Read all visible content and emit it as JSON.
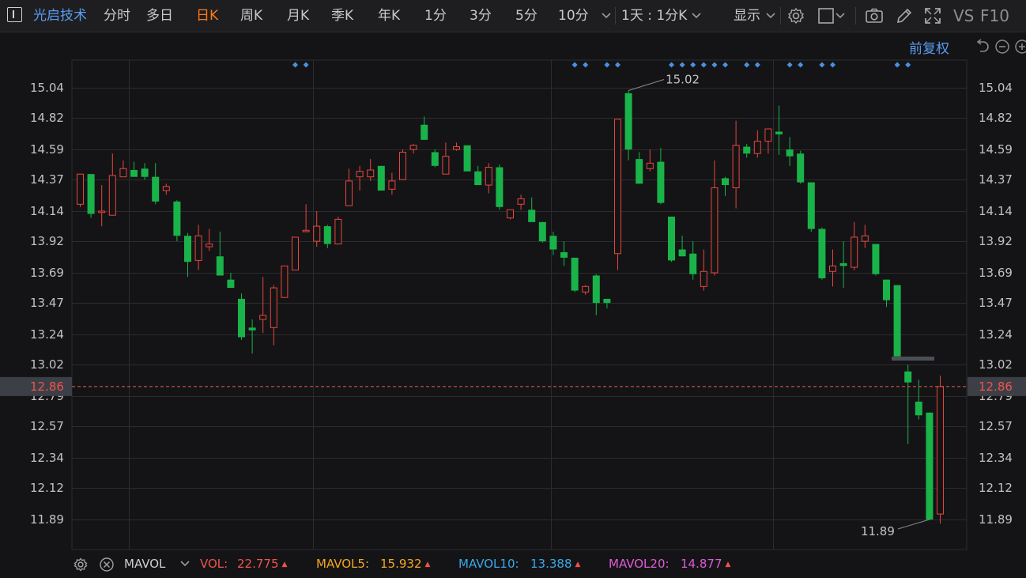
{
  "toolbar": {
    "stock_name": "光启技术",
    "periods": [
      "分时",
      "多日",
      "日K",
      "周K",
      "月K",
      "季K",
      "年K",
      "1分",
      "3分",
      "5分",
      "10分"
    ],
    "active_period": "日K",
    "interval_label": "1天 : 1分K",
    "display_label": "显示",
    "extra_labels": [
      "VS",
      "F10"
    ]
  },
  "sub_toolbar": {
    "adjust_label": "前复权"
  },
  "price_axis": {
    "ticks": [
      "15.04",
      "14.82",
      "14.59",
      "14.37",
      "14.14",
      "13.92",
      "13.69",
      "13.47",
      "13.24",
      "13.02",
      "12.79",
      "12.57",
      "12.34",
      "12.12",
      "11.89"
    ],
    "current_price": "12.86"
  },
  "annotations": {
    "high_label": "15.02",
    "low_label": "11.89"
  },
  "indicator_bar": {
    "name": "MAVOL",
    "items": [
      {
        "label": "VOL:",
        "value": "22.775",
        "color": "#f0524f"
      },
      {
        "label": "MAVOL5:",
        "value": "15.932",
        "color": "#f5a623"
      },
      {
        "label": "MAVOL10:",
        "value": "13.388",
        "color": "#38a8e8"
      },
      {
        "label": "MAVOL20:",
        "value": "14.877",
        "color": "#e05ad8"
      }
    ]
  },
  "colors": {
    "up": "#e8453c",
    "down": "#19b34a",
    "marker": "#4a90e2",
    "grid": "#2c2c30",
    "current_price_line": "#e8603c"
  },
  "chart_data": {
    "type": "candlestick",
    "ylim": [
      11.89,
      15.04
    ],
    "y_ticks": [
      15.04,
      14.82,
      14.59,
      14.37,
      14.14,
      13.92,
      13.69,
      13.47,
      13.24,
      13.02,
      12.79,
      12.57,
      12.34,
      12.12,
      11.89
    ],
    "current_price": 12.86,
    "candles": [
      {
        "o": 14.19,
        "h": 14.41,
        "l": 14.17,
        "c": 14.41
      },
      {
        "o": 14.41,
        "h": 14.41,
        "l": 14.09,
        "c": 14.12
      },
      {
        "o": 14.13,
        "h": 14.33,
        "l": 14.03,
        "c": 14.14
      },
      {
        "o": 14.11,
        "h": 14.56,
        "l": 14.11,
        "c": 14.4
      },
      {
        "o": 14.39,
        "h": 14.51,
        "l": 14.39,
        "c": 14.45
      },
      {
        "o": 14.44,
        "h": 14.5,
        "l": 14.39,
        "c": 14.39
      },
      {
        "o": 14.45,
        "h": 14.49,
        "l": 14.37,
        "c": 14.39
      },
      {
        "o": 14.39,
        "h": 14.49,
        "l": 14.19,
        "c": 14.21
      },
      {
        "o": 14.29,
        "h": 14.34,
        "l": 14.26,
        "c": 14.32
      },
      {
        "o": 14.21,
        "h": 14.22,
        "l": 13.92,
        "c": 13.96
      },
      {
        "o": 13.96,
        "h": 13.98,
        "l": 13.66,
        "c": 13.77
      },
      {
        "o": 13.78,
        "h": 14.04,
        "l": 13.71,
        "c": 13.96
      },
      {
        "o": 13.88,
        "h": 14.01,
        "l": 13.85,
        "c": 13.9
      },
      {
        "o": 13.81,
        "h": 13.99,
        "l": 13.7,
        "c": 13.67
      },
      {
        "o": 13.64,
        "h": 13.69,
        "l": 13.6,
        "c": 13.58
      },
      {
        "o": 13.5,
        "h": 13.54,
        "l": 13.2,
        "c": 13.22
      },
      {
        "o": 13.29,
        "h": 13.35,
        "l": 13.1,
        "c": 13.27
      },
      {
        "o": 13.35,
        "h": 13.66,
        "l": 13.25,
        "c": 13.38
      },
      {
        "o": 13.29,
        "h": 13.6,
        "l": 13.16,
        "c": 13.58
      },
      {
        "o": 13.51,
        "h": 13.74,
        "l": 13.51,
        "c": 13.74
      },
      {
        "o": 13.71,
        "h": 13.95,
        "l": 13.71,
        "c": 13.95
      },
      {
        "o": 13.99,
        "h": 14.19,
        "l": 13.99,
        "c": 14.0
      },
      {
        "o": 13.92,
        "h": 14.14,
        "l": 13.88,
        "c": 14.03
      },
      {
        "o": 14.03,
        "h": 14.04,
        "l": 13.87,
        "c": 13.9
      },
      {
        "o": 13.9,
        "h": 14.1,
        "l": 13.9,
        "c": 14.08
      },
      {
        "o": 14.18,
        "h": 14.45,
        "l": 14.18,
        "c": 14.36
      },
      {
        "o": 14.39,
        "h": 14.47,
        "l": 14.29,
        "c": 14.43
      },
      {
        "o": 14.39,
        "h": 14.52,
        "l": 14.36,
        "c": 14.44
      },
      {
        "o": 14.47,
        "h": 14.47,
        "l": 14.29,
        "c": 14.29
      },
      {
        "o": 14.3,
        "h": 14.42,
        "l": 14.26,
        "c": 14.36
      },
      {
        "o": 14.37,
        "h": 14.59,
        "l": 14.37,
        "c": 14.57
      },
      {
        "o": 14.59,
        "h": 14.63,
        "l": 14.56,
        "c": 14.62
      },
      {
        "o": 14.77,
        "h": 14.83,
        "l": 14.67,
        "c": 14.66
      },
      {
        "o": 14.57,
        "h": 14.59,
        "l": 14.46,
        "c": 14.47
      },
      {
        "o": 14.41,
        "h": 14.64,
        "l": 14.45,
        "c": 14.54
      },
      {
        "o": 14.59,
        "h": 14.64,
        "l": 14.58,
        "c": 14.61
      },
      {
        "o": 14.62,
        "h": 14.62,
        "l": 14.43,
        "c": 14.43
      },
      {
        "o": 14.43,
        "h": 14.47,
        "l": 14.34,
        "c": 14.33
      },
      {
        "o": 14.33,
        "h": 14.49,
        "l": 14.27,
        "c": 14.46
      },
      {
        "o": 14.46,
        "h": 14.48,
        "l": 14.15,
        "c": 14.17
      },
      {
        "o": 14.09,
        "h": 14.15,
        "l": 14.08,
        "c": 14.15
      },
      {
        "o": 14.19,
        "h": 14.26,
        "l": 14.15,
        "c": 14.23
      },
      {
        "o": 14.15,
        "h": 14.24,
        "l": 14.1,
        "c": 14.06
      },
      {
        "o": 14.06,
        "h": 14.06,
        "l": 13.91,
        "c": 13.92
      },
      {
        "o": 13.96,
        "h": 13.99,
        "l": 13.82,
        "c": 13.86
      },
      {
        "o": 13.84,
        "h": 13.92,
        "l": 13.74,
        "c": 13.8
      },
      {
        "o": 13.8,
        "h": 13.8,
        "l": 13.55,
        "c": 13.56
      },
      {
        "o": 13.55,
        "h": 13.6,
        "l": 13.53,
        "c": 13.59
      },
      {
        "o": 13.67,
        "h": 13.68,
        "l": 13.38,
        "c": 13.47
      },
      {
        "o": 13.5,
        "h": 13.5,
        "l": 13.43,
        "c": 13.47
      },
      {
        "o": 13.83,
        "h": 14.81,
        "l": 13.71,
        "c": 14.81
      },
      {
        "o": 15.0,
        "h": 15.02,
        "l": 14.51,
        "c": 14.59
      },
      {
        "o": 14.52,
        "h": 14.57,
        "l": 14.34,
        "c": 14.34
      },
      {
        "o": 14.45,
        "h": 14.59,
        "l": 14.43,
        "c": 14.49
      },
      {
        "o": 14.5,
        "h": 14.6,
        "l": 14.19,
        "c": 14.2
      },
      {
        "o": 14.1,
        "h": 14.1,
        "l": 13.77,
        "c": 13.78
      },
      {
        "o": 13.86,
        "h": 13.96,
        "l": 13.81,
        "c": 13.81
      },
      {
        "o": 13.83,
        "h": 13.92,
        "l": 13.64,
        "c": 13.68
      },
      {
        "o": 13.59,
        "h": 13.86,
        "l": 13.56,
        "c": 13.7
      },
      {
        "o": 13.69,
        "h": 14.51,
        "l": 13.67,
        "c": 14.31
      },
      {
        "o": 14.38,
        "h": 14.39,
        "l": 14.25,
        "c": 14.33
      },
      {
        "o": 14.31,
        "h": 14.8,
        "l": 14.16,
        "c": 14.62
      },
      {
        "o": 14.61,
        "h": 14.63,
        "l": 14.53,
        "c": 14.56
      },
      {
        "o": 14.56,
        "h": 14.73,
        "l": 14.53,
        "c": 14.65
      },
      {
        "o": 14.65,
        "h": 14.71,
        "l": 14.56,
        "c": 14.74
      },
      {
        "o": 14.72,
        "h": 14.91,
        "l": 14.55,
        "c": 14.7
      },
      {
        "o": 14.59,
        "h": 14.68,
        "l": 14.47,
        "c": 14.54
      },
      {
        "o": 14.56,
        "h": 14.58,
        "l": 14.34,
        "c": 14.35
      },
      {
        "o": 14.35,
        "h": 14.35,
        "l": 13.99,
        "c": 14.01
      },
      {
        "o": 14.01,
        "h": 14.02,
        "l": 13.64,
        "c": 13.65
      },
      {
        "o": 13.7,
        "h": 13.86,
        "l": 13.59,
        "c": 13.74
      },
      {
        "o": 13.76,
        "h": 13.92,
        "l": 13.58,
        "c": 13.74
      },
      {
        "o": 13.73,
        "h": 14.06,
        "l": 13.71,
        "c": 13.95
      },
      {
        "o": 13.92,
        "h": 14.04,
        "l": 13.87,
        "c": 13.96
      },
      {
        "o": 13.9,
        "h": 13.9,
        "l": 13.67,
        "c": 13.68
      },
      {
        "o": 13.64,
        "h": 13.64,
        "l": 13.44,
        "c": 13.49
      },
      {
        "o": 13.6,
        "h": 13.6,
        "l": 13.08,
        "c": 13.08
      },
      {
        "o": 12.97,
        "h": 13.02,
        "l": 12.44,
        "c": 12.89
      },
      {
        "o": 12.75,
        "h": 12.91,
        "l": 12.62,
        "c": 12.65
      },
      {
        "o": 12.67,
        "h": 12.67,
        "l": 11.89,
        "c": 11.89
      },
      {
        "o": 11.93,
        "h": 12.94,
        "l": 11.86,
        "c": 12.86
      }
    ],
    "marker_indices": [
      20,
      21,
      46,
      47,
      49,
      50,
      55,
      56,
      57,
      58,
      59,
      60,
      62,
      63,
      66,
      67,
      69,
      70,
      76,
      77
    ]
  }
}
